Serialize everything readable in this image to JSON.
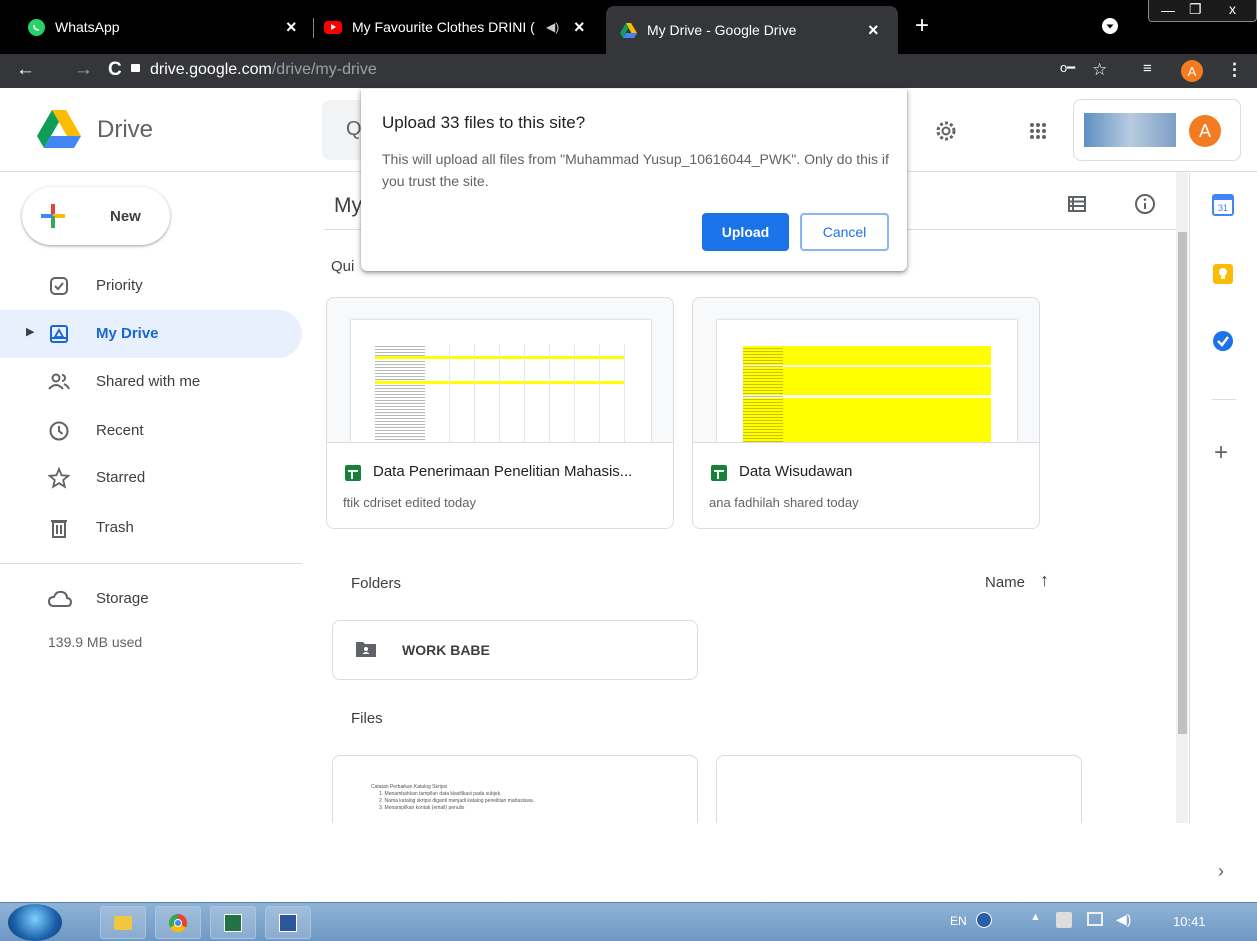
{
  "browser": {
    "tabs": [
      {
        "title": "WhatsApp",
        "active": false
      },
      {
        "title": "My Favourite Clothes DRINI (",
        "active": false
      },
      {
        "title": "My Drive - Google Drive",
        "active": true
      }
    ],
    "url_host": "drive.google.com",
    "url_path": "/drive/my-drive",
    "profile_initial": "A"
  },
  "header": {
    "app_name": "Drive",
    "search_glyph": "Q",
    "avatar_initial": "A"
  },
  "sidebar": {
    "new_label": "New",
    "items": [
      {
        "label": "Priority",
        "icon": "priority-icon"
      },
      {
        "label": "My Drive",
        "icon": "my-drive-icon",
        "active": true
      },
      {
        "label": "Shared with me",
        "icon": "shared-icon"
      },
      {
        "label": "Recent",
        "icon": "clock-icon"
      },
      {
        "label": "Starred",
        "icon": "star-icon"
      },
      {
        "label": "Trash",
        "icon": "trash-icon"
      }
    ],
    "storage_label": "Storage",
    "storage_used": "139.9 MB used"
  },
  "main": {
    "title": "My",
    "quick_access_label": "Qui",
    "quick_access": [
      {
        "name": "Data Penerimaan Penelitian Mahasis...",
        "subtitle": "ftik cdriset edited today"
      },
      {
        "name": "Data Wisudawan",
        "subtitle": "ana fadhilah shared today"
      }
    ],
    "folders_label": "Folders",
    "sort_label": "Name",
    "folders": [
      {
        "name": "WORK BABE"
      }
    ],
    "files_label": "Files",
    "file_preview_lines": [
      "Catatan Perbaikan Katalog Skripsi",
      "1. Menambahkan tampilan data klasifikasi pada subjek.",
      "2. Nama katalog skripsi diganti menjadi katalog penelitian mahasiswa.",
      "3. Menampilkan kontak (email) penulis"
    ]
  },
  "dialog": {
    "title": "Upload 33 files to this site?",
    "body": "This will upload all files from \"Muhammad Yusup_10616044_PWK\". Only do this if you trust the site.",
    "upload_label": "Upload",
    "cancel_label": "Cancel"
  },
  "taskbar": {
    "lang": "EN",
    "time": "10:41"
  },
  "colors": {
    "accent": "#1a73e8",
    "active_nav_bg": "#e8f0fe",
    "active_nav_text": "#1967d2",
    "sheet_highlight": "#ffff00",
    "avatar": "#f37b22"
  }
}
